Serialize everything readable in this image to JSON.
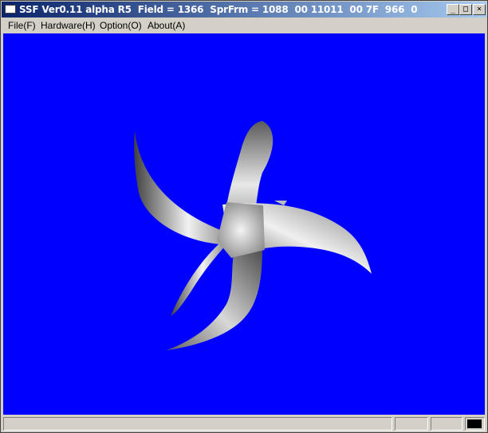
{
  "window": {
    "title": "SSF Ver0.11 alpha R5  Field = 1366  SprFrm = 1088  00 11011  00 7F  966  0",
    "minimize_glyph": "_",
    "maximize_glyph": "□",
    "close_glyph": "×"
  },
  "menu": {
    "file": "File(F)",
    "hardware": "Hardware(H)",
    "option": "Option(O)",
    "about": "About(A)"
  },
  "icons": {
    "app": "window-icon",
    "minimize": "minimize-icon",
    "maximize": "maximize-icon",
    "close": "close-icon"
  },
  "colors": {
    "viewport_background": "#0000ff",
    "titlebar_start": "#0a246a",
    "titlebar_end": "#a6caf0",
    "status_indicator": "#000000"
  }
}
